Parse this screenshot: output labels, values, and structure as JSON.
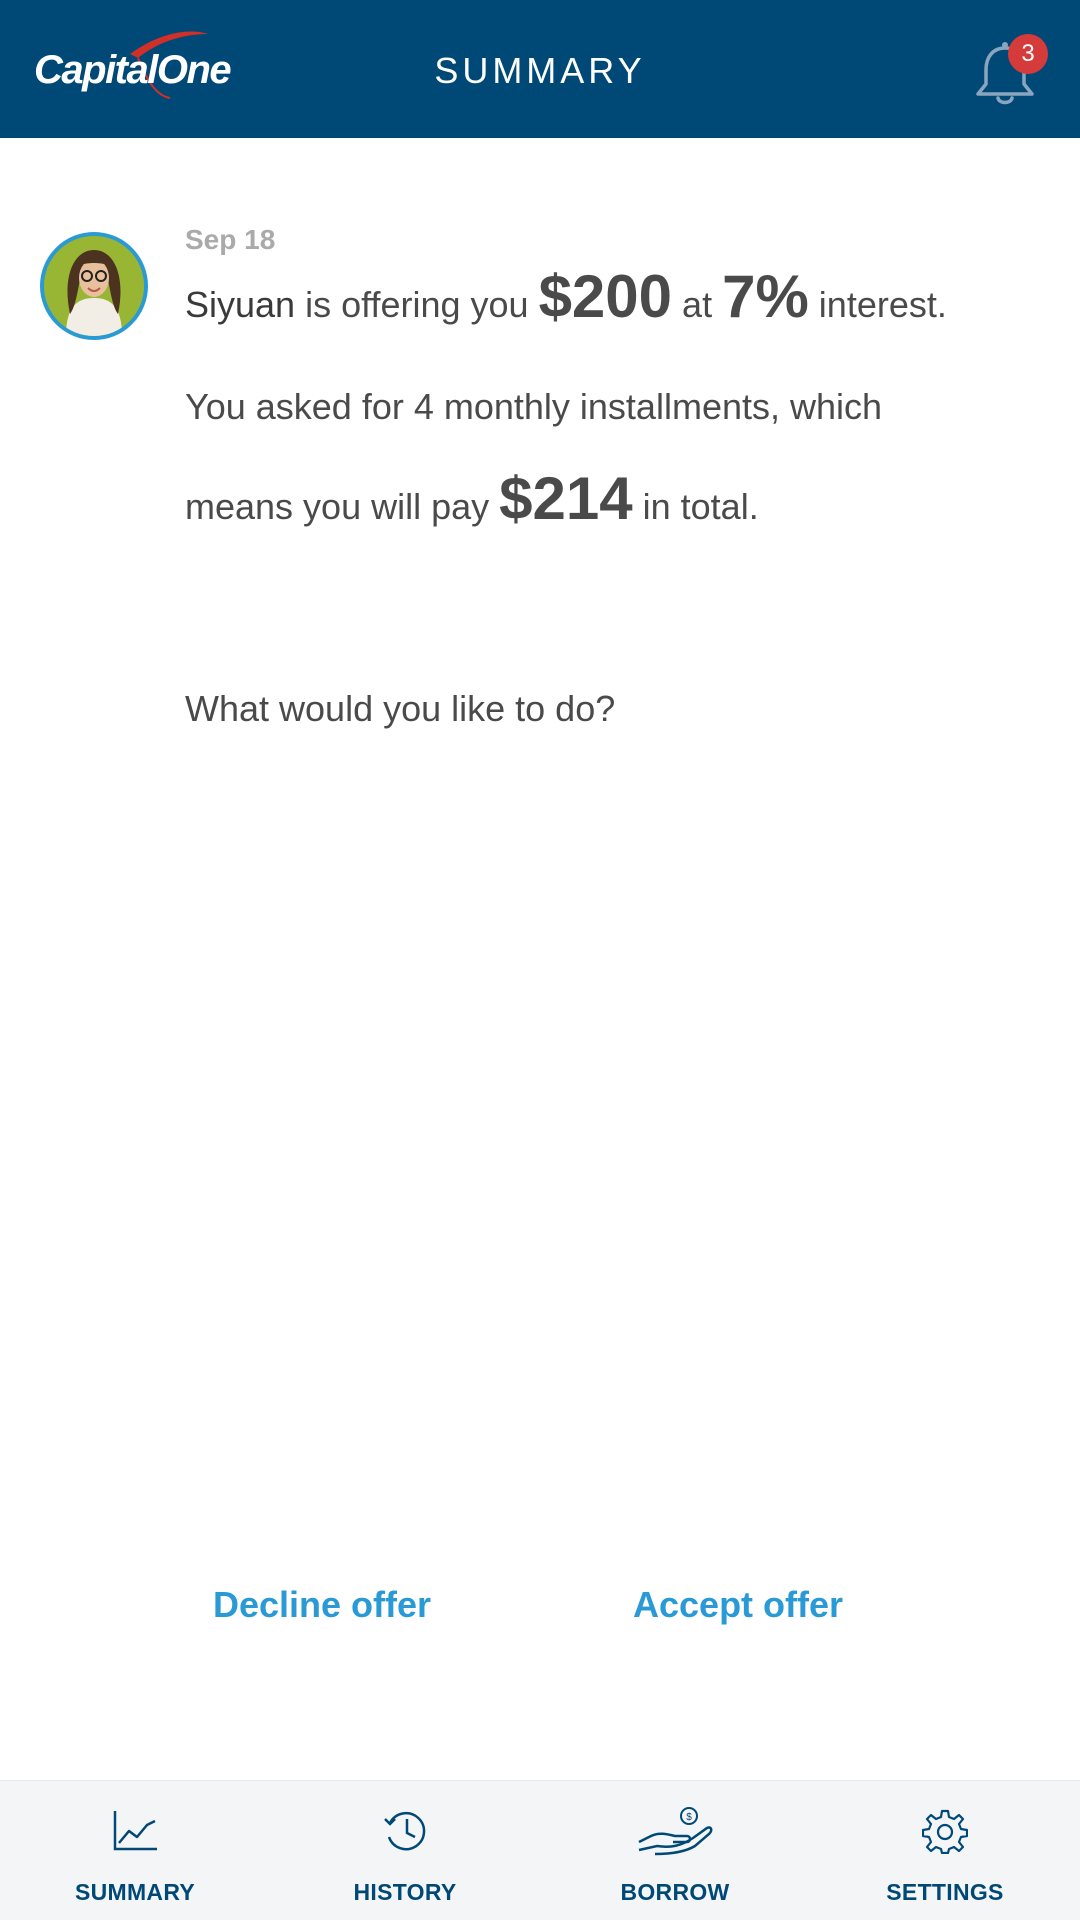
{
  "colors": {
    "brand_blue": "#004977",
    "accent_blue": "#2a9ad6",
    "badge_red": "#d63b3b",
    "text_gray": "#4a4a4a",
    "date_gray": "#aaaaaa",
    "tabbar_bg": "#f4f5f7"
  },
  "header": {
    "logo_text": "CapitalOne",
    "title": "SUMMARY",
    "notifications_icon": "bell-icon",
    "notification_count": "3"
  },
  "offer": {
    "avatar_icon": "user-avatar",
    "date": "Sep 18",
    "lender_name": "Siyuan",
    "offering_text": " is offering you ",
    "amount": "$200",
    "at_text": " at ",
    "rate": "7%",
    "interest_text": " interest.",
    "installments_text": "You asked for 4 monthly installments, which",
    "pay_prefix": "means you will pay ",
    "total": "$214",
    "pay_suffix": " in total.",
    "prompt": "What would you like to do?"
  },
  "actions": {
    "decline_label": "Decline offer",
    "accept_label": "Accept offer"
  },
  "tabs": [
    {
      "label": "SUMMARY",
      "icon": "line-chart-icon"
    },
    {
      "label": "HISTORY",
      "icon": "history-clock-icon"
    },
    {
      "label": "BORROW",
      "icon": "hand-coin-icon"
    },
    {
      "label": "SETTINGS",
      "icon": "gear-icon"
    }
  ]
}
